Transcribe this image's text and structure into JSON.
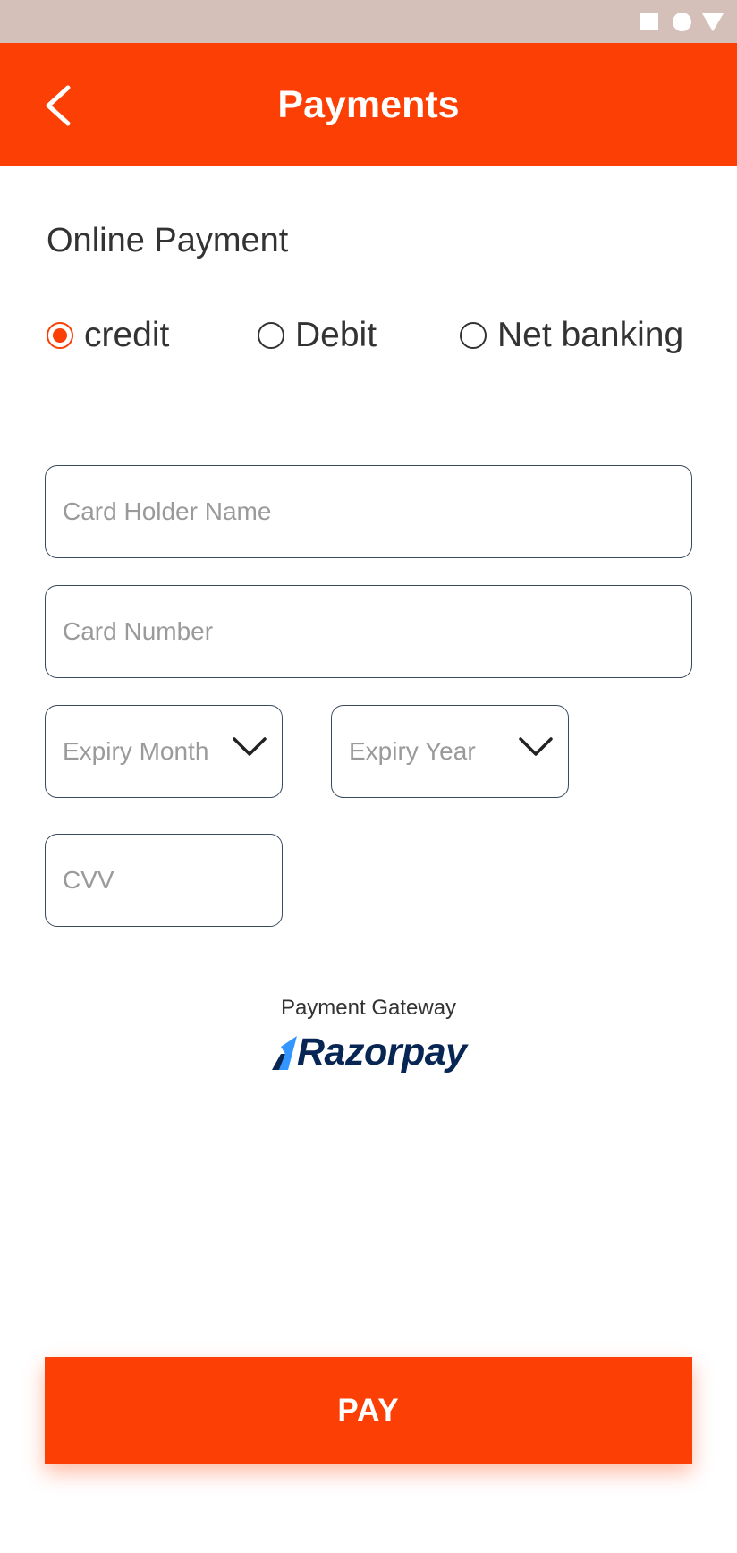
{
  "header": {
    "title": "Payments",
    "back_icon": "chevron-left-icon"
  },
  "section_title": "Online Payment",
  "payment_methods": [
    {
      "label": "credit",
      "selected": true
    },
    {
      "label": "Debit",
      "selected": false
    },
    {
      "label": "Net banking",
      "selected": false
    }
  ],
  "fields": {
    "card_holder_name": {
      "placeholder": "Card Holder Name",
      "value": ""
    },
    "card_number": {
      "placeholder": "Card Number",
      "value": ""
    },
    "expiry_month": {
      "placeholder": "Expiry Month",
      "icon": "chevron-down-icon"
    },
    "expiry_year": {
      "placeholder": "Expiry Year",
      "icon": "chevron-down-icon"
    },
    "cvv": {
      "placeholder": "CVV",
      "value": ""
    }
  },
  "gateway": {
    "label": "Payment Gateway",
    "brand": "Razorpay"
  },
  "pay_button": {
    "label": "PAY"
  },
  "colors": {
    "accent": "#fc3f04",
    "status_bar": "#d4c0b9",
    "brand_navy": "#072654",
    "brand_blue": "#3395ff"
  }
}
